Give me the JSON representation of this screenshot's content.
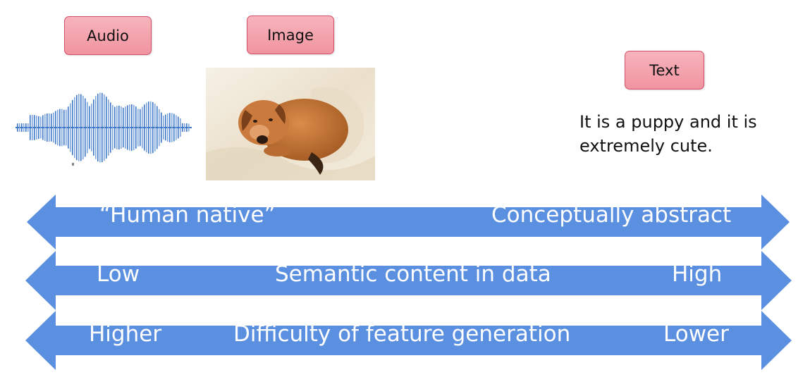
{
  "modalities": {
    "audio_label": "Audio",
    "image_label": "Image",
    "text_label": "Text",
    "text_example": "It is a puppy and it is extremely cute."
  },
  "scales": [
    {
      "left": "“Human native”",
      "middle": "",
      "right": "Conceptually abstract"
    },
    {
      "left": "Low",
      "middle": "Semantic content in data",
      "right": "High"
    },
    {
      "left": "Higher",
      "middle": "Difficulty of feature generation",
      "right": "Lower"
    }
  ],
  "colors": {
    "arrow_fill": "#5b8fe0",
    "label_fill": "#f4a6b0",
    "label_border": "#d4506a",
    "waveform": "#3d78c8"
  },
  "icons": {
    "audio": "waveform-icon",
    "image": "puppy-photo"
  }
}
